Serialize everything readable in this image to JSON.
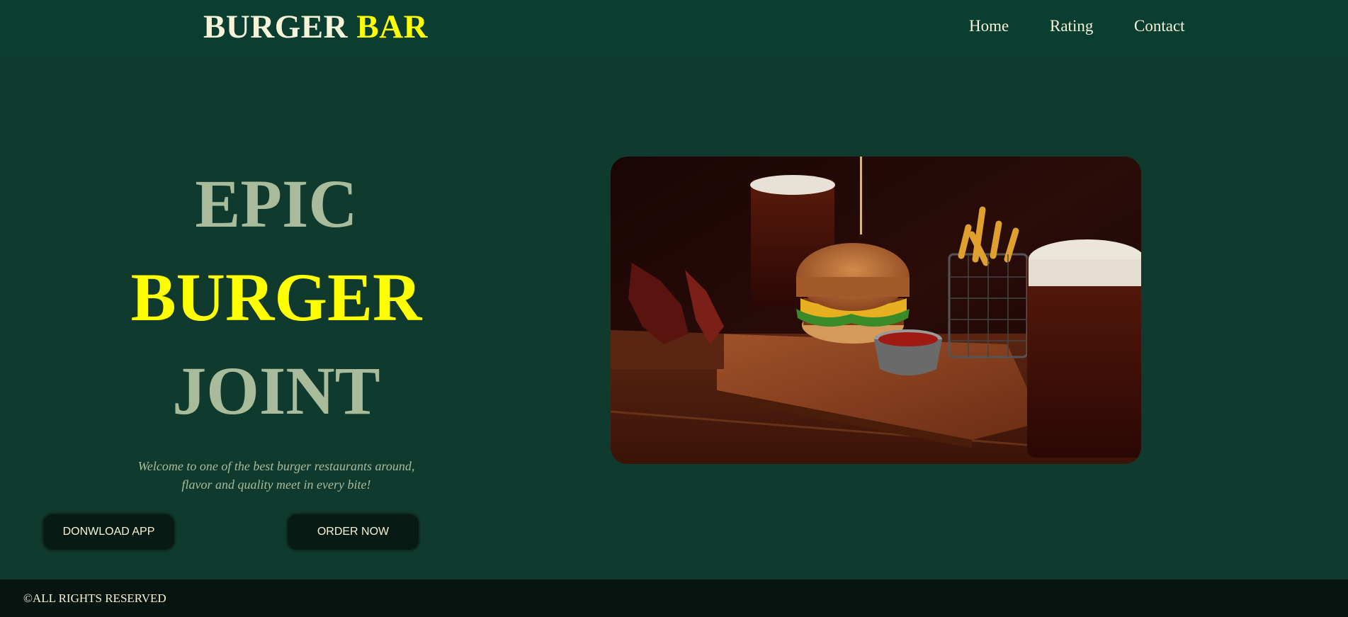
{
  "brand": {
    "word1": "BURGER",
    "word2": "BAR"
  },
  "nav": {
    "items": [
      {
        "label": "Home"
      },
      {
        "label": "Rating"
      },
      {
        "label": "Contact"
      }
    ]
  },
  "hero": {
    "line1": "EPIC",
    "line2": "BURGER",
    "line3": "JOINT",
    "tagline_line1": "Welcome to one of the best burger restaurants around,",
    "tagline_line2": "flavor and quality meet in every bite!",
    "image_subject": "burger with fries and beer on wooden board"
  },
  "buttons": {
    "download": "DONWLOAD APP",
    "order": "ORDER NOW"
  },
  "footer": {
    "text": "©ALL RIGHTS RESERVED"
  },
  "colors": {
    "navbar_bg": "#0a3e31",
    "page_bg": "#113a2e",
    "accent_yellow": "#ffff00",
    "muted_green": "#a8bb9b",
    "cream": "#f5f3d8",
    "button_bg": "#081a14",
    "footer_bg": "#081410"
  }
}
